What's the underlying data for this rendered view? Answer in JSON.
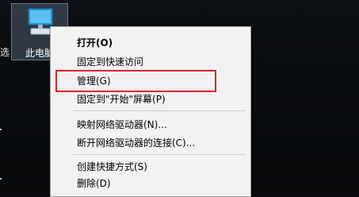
{
  "desktop": {
    "side_label": "选",
    "icon": {
      "name": "pc-icon",
      "label": "此电脑"
    }
  },
  "menu": {
    "items": [
      {
        "label": "打开(O)"
      },
      {
        "label": "固定到快速访问"
      },
      {
        "label": "管理(G)"
      },
      {
        "label": "固定到\"开始\"屏幕(P)"
      },
      {
        "label": "映射网络驱动器(N)..."
      },
      {
        "label": "断开网络驱动器的连接(C)..."
      },
      {
        "label": "创建快捷方式(S)"
      },
      {
        "label": "删除(D)"
      }
    ],
    "highlight_color": "#e0232a"
  }
}
